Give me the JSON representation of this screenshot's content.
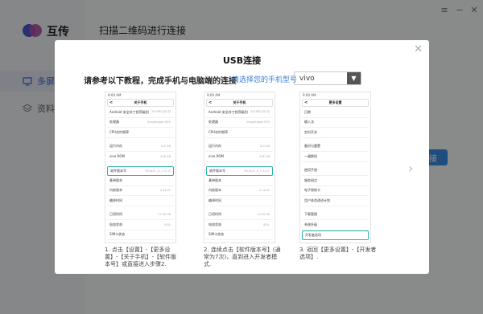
{
  "app": {
    "name": "互传",
    "page_title": "扫描二维码进行连接",
    "sidebar": [
      {
        "label": "多屏互",
        "active": true
      },
      {
        "label": "资料("
      }
    ],
    "bg_button": "接",
    "colors": {
      "accent": "#3a6bd6",
      "highlight": "#2bb4a8"
    }
  },
  "modal": {
    "title": "USB连接",
    "instruction": "请参考以下教程，完成手机与电脑端的连接",
    "model_link": "请选择您的手机型号",
    "selected_model": "vivo",
    "steps": [
      {
        "header": "关于手机",
        "status": "9:00 AM",
        "rows": [
          {
            "label": "Android 安全补丁程序级别",
            "value": "2019年1月1日"
          },
          {
            "label": "处理器",
            "value": "Snapdragon 855"
          },
          {
            "label": "CPU实时频率",
            "value": ""
          },
          {
            "label": "运行内存",
            "value": "8.0 GB"
          },
          {
            "label": "vivo ROM",
            "value": "256 GB"
          },
          {
            "label": "软件版本号",
            "value": "PD1821_A_1.12.4",
            "highlight": true
          },
          {
            "label": "基带版本",
            "value": ""
          },
          {
            "label": "内核版本",
            "value": "4.14.83"
          },
          {
            "label": "编译时间",
            "value": ""
          },
          {
            "label": "已用时间",
            "value": "12:45:06"
          },
          {
            "label": "电池状态",
            "value": "85%"
          },
          {
            "label": "SIM卡状态",
            "value": ""
          }
        ],
        "caption": "1. 点击【设置】-【更多设置】-【关于手机】-【软件版本号】或直接进入步骤2."
      },
      {
        "header": "关于手机",
        "status": "9:00 AM",
        "rows": [
          {
            "label": "Android 安全补丁程序级别",
            "value": "2019年1月1日"
          },
          {
            "label": "处理器",
            "value": "Snapdragon 855"
          },
          {
            "label": "CPU实时频率",
            "value": ""
          },
          {
            "label": "运行内存",
            "value": "8.0 GB"
          },
          {
            "label": "vivo ROM",
            "value": "256 GB"
          },
          {
            "label": "软件版本号",
            "value": "PD1821_A_1.12.4",
            "highlight": true
          },
          {
            "label": "基带版本",
            "value": ""
          },
          {
            "label": "内核版本",
            "value": "4.14.83"
          },
          {
            "label": "编译时间",
            "value": ""
          },
          {
            "label": "已用时间",
            "value": "12:45:06"
          },
          {
            "label": "电池状态",
            "value": "85%"
          },
          {
            "label": "SIM卡状态",
            "value": ""
          }
        ],
        "caption": "2. 连续点击【软件版本号】(通常为7次)，直到进入开发者模式."
      },
      {
        "header": "更多设置",
        "status": "9:00 AM",
        "rows": [
          {
            "label": "日期",
            "value": ""
          },
          {
            "label": "输入法",
            "value": ""
          },
          {
            "label": "定时开关",
            "value": ""
          },
          {
            "label": "备份与重置",
            "value": ""
          },
          {
            "label": "一键换机",
            "value": ""
          },
          {
            "label": "使用手册",
            "value": ""
          },
          {
            "label": "服务网点",
            "value": ""
          },
          {
            "label": "电子保修卡",
            "value": ""
          },
          {
            "label": "用户体验改进计划",
            "value": ""
          },
          {
            "label": "下载管理",
            "value": ""
          },
          {
            "label": "系统升级",
            "value": ""
          },
          {
            "label": "开发者选项",
            "value": "",
            "highlight": true
          }
        ],
        "caption": "3. 返回【更多设置】-【开发者选项】."
      }
    ]
  }
}
